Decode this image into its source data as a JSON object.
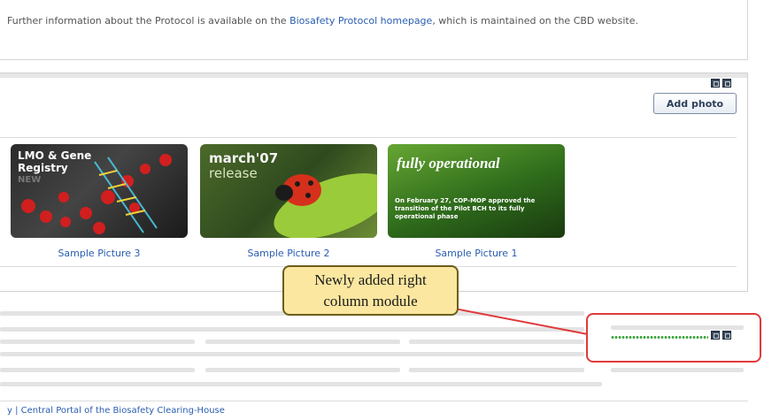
{
  "info": {
    "text_before": "Further information about the Protocol is available on the ",
    "link": "Biosafety Protocol homepage",
    "text_after": ", which is maintained on the CBD website."
  },
  "gallery": {
    "add_photo_label": "Add photo",
    "pictures": [
      {
        "caption": "Sample Picture 3",
        "title_line1": "LMO & Gene",
        "title_line2": "Registry",
        "tag": "NEW"
      },
      {
        "caption": "Sample Picture 2",
        "title_line1": "march'07",
        "title_line2": "release"
      },
      {
        "caption": "Sample Picture 1",
        "title_line1": "fully operational",
        "body": "On February 27, COP-MOP approved the transition of the Pilot BCH to its fully operational phase"
      }
    ]
  },
  "callout": {
    "line1": "Newly added right",
    "line2": "column module"
  },
  "footer": {
    "text": "y | Central Portal of the Biosafety Clearing-House"
  },
  "colors": {
    "link": "#2a5db0",
    "callout_bg": "#fbe7a0",
    "highlight": "#e03a3a",
    "module_dots": "#44a844"
  },
  "icons": [
    "minimize-icon",
    "maximize-icon"
  ]
}
